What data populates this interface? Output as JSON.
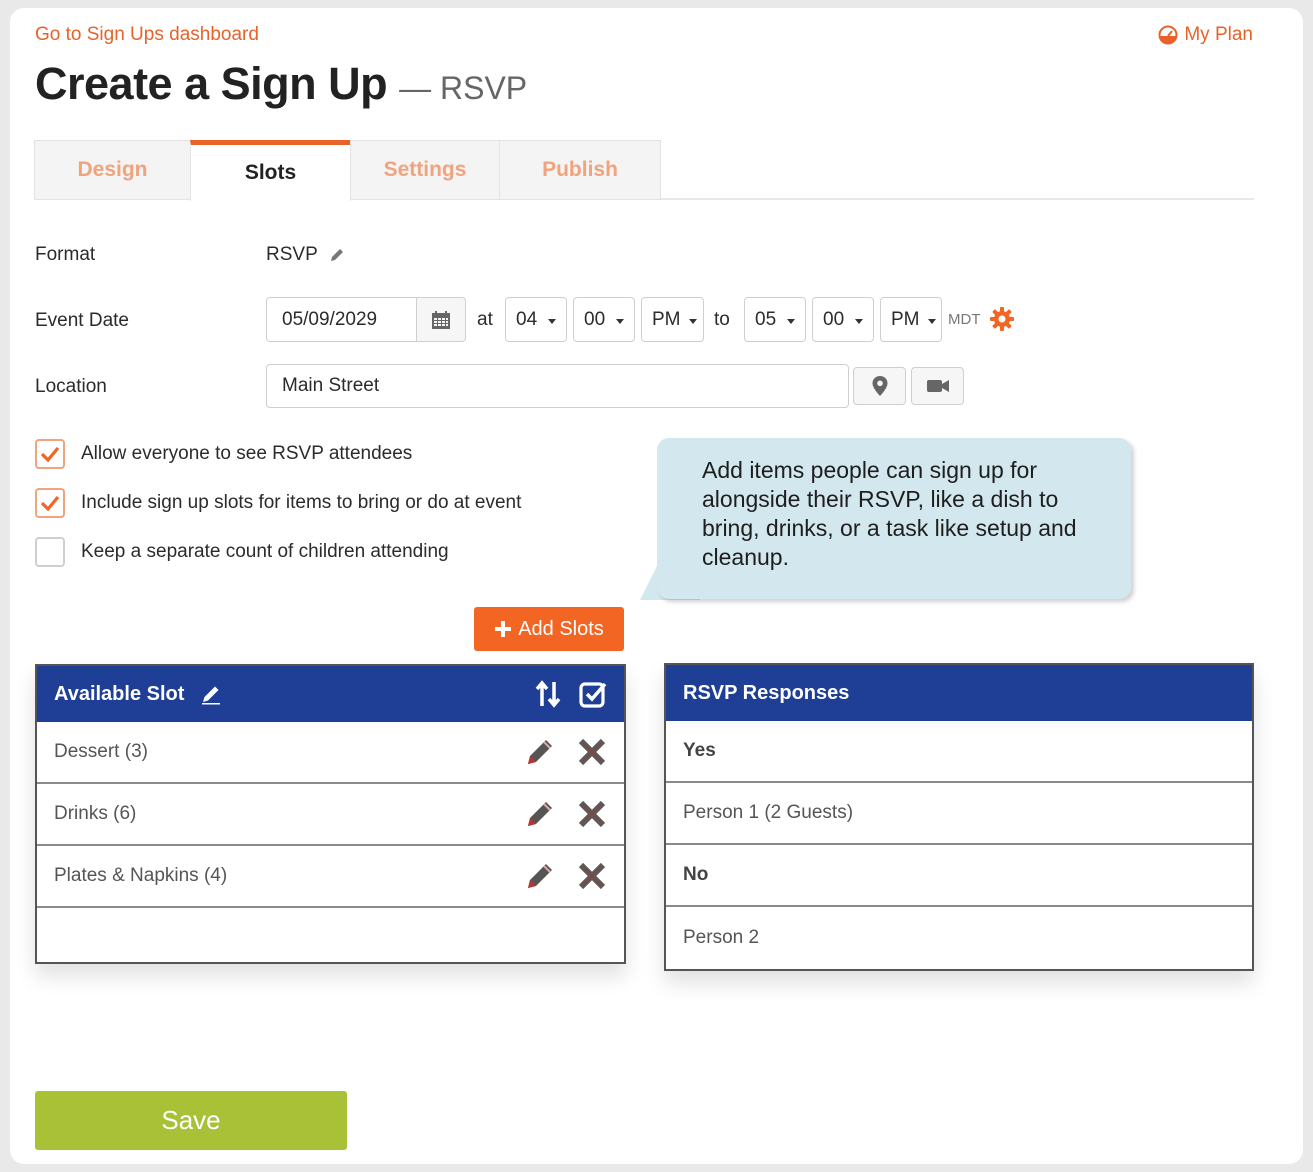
{
  "header": {
    "dashboard_link": "Go to Sign Ups dashboard",
    "my_plan": "My Plan",
    "title": "Create a Sign Up",
    "subtitle": "— RSVP"
  },
  "tabs": [
    {
      "label": "Design",
      "active": false
    },
    {
      "label": "Slots",
      "active": true
    },
    {
      "label": "Settings",
      "active": false
    },
    {
      "label": "Publish",
      "active": false
    }
  ],
  "form": {
    "format_label": "Format",
    "format_value": "RSVP",
    "event_date_label": "Event Date",
    "event_date": "05/09/2029",
    "at_label": "at",
    "start_hour": "04",
    "start_minute": "00",
    "start_ampm": "PM",
    "to_label": "to",
    "end_hour": "05",
    "end_minute": "00",
    "end_ampm": "PM",
    "timezone": "MDT",
    "location_label": "Location",
    "location_value": "Main Street"
  },
  "checkboxes": [
    {
      "label": "Allow everyone to see RSVP attendees",
      "checked": true
    },
    {
      "label": "Include sign up slots for items to bring or do at event",
      "checked": true
    },
    {
      "label": "Keep a separate count of children attending",
      "checked": false
    }
  ],
  "tooltip": "Add items people can sign up for alongside their RSVP, like a dish to bring, drinks, or a task like setup and cleanup.",
  "add_slots_label": "Add Slots",
  "slots_panel": {
    "header": "Available Slot",
    "rows": [
      "Dessert (3)",
      "Drinks (6)",
      "Plates & Napkins (4)"
    ]
  },
  "rsvp_panel": {
    "header": "RSVP Responses",
    "rows": [
      {
        "text": "Yes",
        "bold": true
      },
      {
        "text": "Person 1 (2 Guests)",
        "bold": false
      },
      {
        "text": "No",
        "bold": true
      },
      {
        "text": "Person 2",
        "bold": false
      }
    ]
  },
  "save_label": "Save",
  "colors": {
    "accent": "#e8622a",
    "panel_header": "#1f3f96",
    "save": "#a8c137",
    "tooltip": "#d3e7ee"
  }
}
